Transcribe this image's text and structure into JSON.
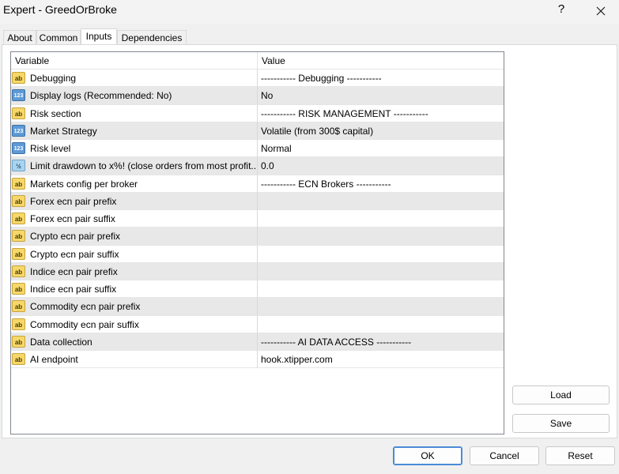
{
  "window": {
    "title": "Expert - GreedOrBroke",
    "help_label": "?"
  },
  "tabs": [
    "About",
    "Common",
    "Inputs",
    "Dependencies"
  ],
  "grid": {
    "headers": {
      "variable": "Variable",
      "value": "Value"
    },
    "rows": [
      {
        "icon": "ab",
        "icon_text": "ab",
        "variable": "Debugging",
        "value": "----------- Debugging -----------"
      },
      {
        "icon": "num",
        "icon_text": "123",
        "variable": "Display logs (Recommended: No)",
        "value": "No"
      },
      {
        "icon": "ab",
        "icon_text": "ab",
        "variable": "Risk section",
        "value": "----------- RISK MANAGEMENT -----------"
      },
      {
        "icon": "num",
        "icon_text": "123",
        "variable": "Market Strategy",
        "value": "Volatile (from 300$ capital)"
      },
      {
        "icon": "num",
        "icon_text": "123",
        "variable": "Risk level",
        "value": "Normal"
      },
      {
        "icon": "frac",
        "icon_text": "½",
        "variable": "Limit drawdown to x%! (close orders from most profit...",
        "value": "0.0"
      },
      {
        "icon": "ab",
        "icon_text": "ab",
        "variable": "Markets config per broker",
        "value": "----------- ECN Brokers -----------"
      },
      {
        "icon": "ab",
        "icon_text": "ab",
        "variable": "Forex ecn pair prefix",
        "value": ""
      },
      {
        "icon": "ab",
        "icon_text": "ab",
        "variable": "Forex ecn pair suffix",
        "value": ""
      },
      {
        "icon": "ab",
        "icon_text": "ab",
        "variable": "Crypto ecn pair prefix",
        "value": ""
      },
      {
        "icon": "ab",
        "icon_text": "ab",
        "variable": "Crypto ecn pair suffix",
        "value": ""
      },
      {
        "icon": "ab",
        "icon_text": "ab",
        "variable": "Indice ecn pair prefix",
        "value": ""
      },
      {
        "icon": "ab",
        "icon_text": "ab",
        "variable": "Indice ecn pair suffix",
        "value": ""
      },
      {
        "icon": "ab",
        "icon_text": "ab",
        "variable": "Commodity ecn pair prefix",
        "value": ""
      },
      {
        "icon": "ab",
        "icon_text": "ab",
        "variable": "Commodity ecn pair suffix",
        "value": ""
      },
      {
        "icon": "ab",
        "icon_text": "ab",
        "variable": "Data collection",
        "value": "----------- AI DATA ACCESS -----------"
      },
      {
        "icon": "ab",
        "icon_text": "ab",
        "variable": "AI endpoint",
        "value": "hook.xtipper.com"
      }
    ]
  },
  "buttons": {
    "load": "Load",
    "save": "Save",
    "ok": "OK",
    "cancel": "Cancel",
    "reset": "Reset"
  },
  "colors": {
    "accent": "#4a8bd6",
    "row_alt": "#e8e8e8"
  }
}
